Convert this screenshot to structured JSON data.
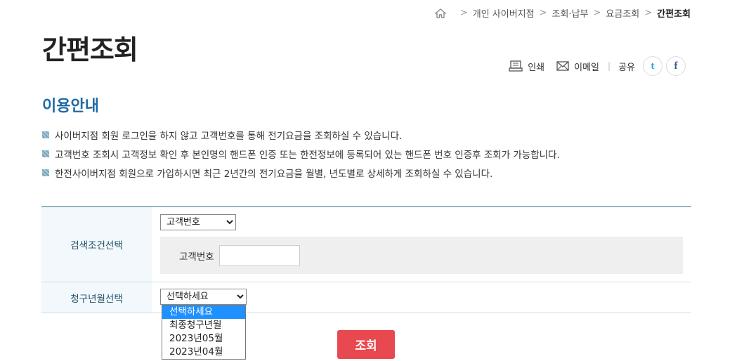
{
  "breadcrumb": {
    "items": [
      "개인 사이버지점",
      "조회·납부",
      "요금조회"
    ],
    "current": "간편조회"
  },
  "title": "간편조회",
  "tools": {
    "print": "인쇄",
    "email": "이메일",
    "share": "공유",
    "twitter": "t",
    "facebook": "f"
  },
  "section_title": "이용안내",
  "info": [
    "사이버지점 회원 로그인을 하지 않고 고객번호를 통해 전기요금을 조회하실 수 있습니다.",
    "고객번호 조회시 고객정보 확인 후 본인명의 핸드폰 인증 또는 한전정보에 등록되어 있는 핸드폰 번호 인증후 조회가 가능합니다.",
    "한전사이버지점 회원으로 가입하시면 최근 2년간의 전기요금을 월별, 년도별로 상세하게 조회하실 수 있습니다."
  ],
  "form": {
    "search_condition_label": "검색조건선택",
    "search_type_selected": "고객번호",
    "customer_number_label": "고객번호",
    "customer_number_value": "",
    "billing_month_label": "청구년월선택",
    "billing_month_selected": "선택하세요",
    "billing_month_options": [
      "선택하세요",
      "최종청구년월",
      "2023년05월",
      "2023년04월"
    ]
  },
  "search_button": "조회",
  "colors": {
    "accent": "#1f6aa5",
    "button": "#e8484f",
    "selected_option": "#1e90ff"
  }
}
